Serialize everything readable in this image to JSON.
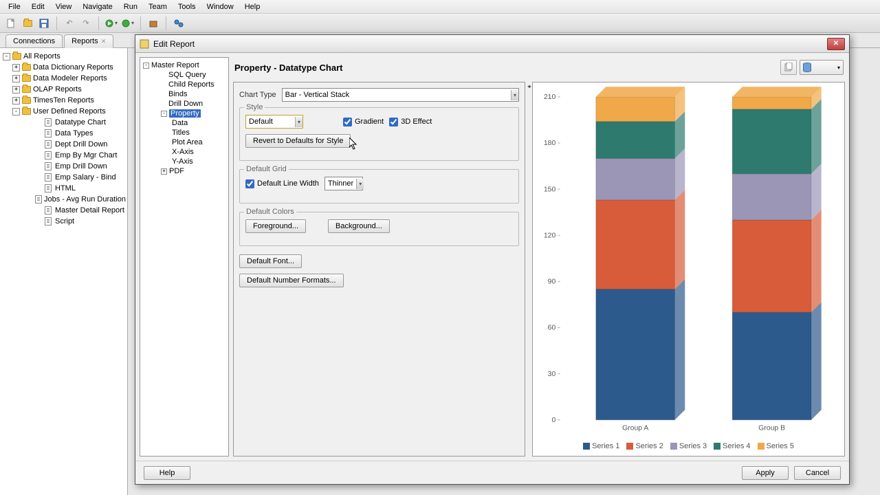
{
  "menubar": [
    "File",
    "Edit",
    "View",
    "Navigate",
    "Run",
    "Team",
    "Tools",
    "Window",
    "Help"
  ],
  "tabs": {
    "connections": "Connections",
    "reports": "Reports"
  },
  "left_tree": [
    {
      "level": 0,
      "exp": "-",
      "icon": "folder",
      "label": "All Reports"
    },
    {
      "level": 1,
      "exp": "+",
      "icon": "folder",
      "label": "Data Dictionary Reports"
    },
    {
      "level": 1,
      "exp": "+",
      "icon": "folder",
      "label": "Data Modeler Reports"
    },
    {
      "level": 1,
      "exp": "+",
      "icon": "folder",
      "label": "OLAP Reports"
    },
    {
      "level": 1,
      "exp": "+",
      "icon": "folder",
      "label": "TimesTen Reports"
    },
    {
      "level": 1,
      "exp": "-",
      "icon": "folder",
      "label": "User Defined Reports"
    },
    {
      "level": 2,
      "exp": "",
      "icon": "report",
      "label": "Datatype Chart"
    },
    {
      "level": 2,
      "exp": "",
      "icon": "report",
      "label": "Data Types"
    },
    {
      "level": 2,
      "exp": "",
      "icon": "report",
      "label": "Dept Drill Down"
    },
    {
      "level": 2,
      "exp": "",
      "icon": "report",
      "label": "Emp By Mgr Chart"
    },
    {
      "level": 2,
      "exp": "",
      "icon": "report",
      "label": "Emp Drill Down"
    },
    {
      "level": 2,
      "exp": "",
      "icon": "report",
      "label": "Emp Salary - Bind"
    },
    {
      "level": 2,
      "exp": "",
      "icon": "report",
      "label": "HTML"
    },
    {
      "level": 2,
      "exp": "",
      "icon": "report",
      "label": "Jobs - Avg Run Duration"
    },
    {
      "level": 2,
      "exp": "",
      "icon": "report",
      "label": "Master Detail Report"
    },
    {
      "level": 2,
      "exp": "",
      "icon": "report",
      "label": "Script"
    }
  ],
  "dialog": {
    "title": "Edit Report",
    "header": "Property - Datatype Chart",
    "tree": [
      {
        "level": 0,
        "exp": "-",
        "label": "Master Report"
      },
      {
        "level": 1,
        "exp": "",
        "label": "SQL Query"
      },
      {
        "level": 1,
        "exp": "",
        "label": "Child Reports"
      },
      {
        "level": 1,
        "exp": "",
        "label": "Binds"
      },
      {
        "level": 1,
        "exp": "",
        "label": "Drill Down"
      },
      {
        "level": 1,
        "exp": "-",
        "label": "Property",
        "selected": true
      },
      {
        "level": 2,
        "exp": "",
        "label": "Data"
      },
      {
        "level": 2,
        "exp": "",
        "label": "Titles"
      },
      {
        "level": 2,
        "exp": "",
        "label": "Plot Area"
      },
      {
        "level": 2,
        "exp": "",
        "label": "X-Axis"
      },
      {
        "level": 2,
        "exp": "",
        "label": "Y-Axis"
      },
      {
        "level": 1,
        "exp": "+",
        "label": "PDF"
      }
    ],
    "chart_type_label": "Chart Type",
    "chart_type_value": "Bar - Vertical Stack",
    "style_legend": "Style",
    "style_value": "Default",
    "gradient_label": "Gradient",
    "gradient_checked": true,
    "effect3d_label": "3D Effect",
    "effect3d_checked": true,
    "revert_label": "Revert to Defaults for Style",
    "grid_legend": "Default Grid",
    "line_width_label": "Default Line Width",
    "line_width_checked": true,
    "line_width_value": "Thinner",
    "colors_legend": "Default Colors",
    "foreground_label": "Foreground...",
    "background_label": "Background...",
    "font_label": "Default Font...",
    "number_fmt_label": "Default Number Formats...",
    "help_label": "Help",
    "apply_label": "Apply",
    "cancel_label": "Cancel"
  },
  "chart_data": {
    "type": "bar",
    "stacked": true,
    "categories": [
      "Group A",
      "Group B"
    ],
    "series": [
      {
        "name": "Series 1",
        "color": "#2d5a8c",
        "values": [
          85,
          70
        ]
      },
      {
        "name": "Series 2",
        "color": "#d85c3a",
        "values": [
          58,
          60
        ]
      },
      {
        "name": "Series 3",
        "color": "#9b95b6",
        "values": [
          27,
          30
        ]
      },
      {
        "name": "Series 4",
        "color": "#2e7a6f",
        "values": [
          24,
          42
        ]
      },
      {
        "name": "Series 5",
        "color": "#f0a848",
        "values": [
          16,
          8
        ]
      }
    ],
    "ylim": [
      0,
      210
    ],
    "yticks": [
      0,
      30,
      60,
      90,
      120,
      150,
      180,
      210
    ],
    "xlabel": "",
    "ylabel": ""
  }
}
